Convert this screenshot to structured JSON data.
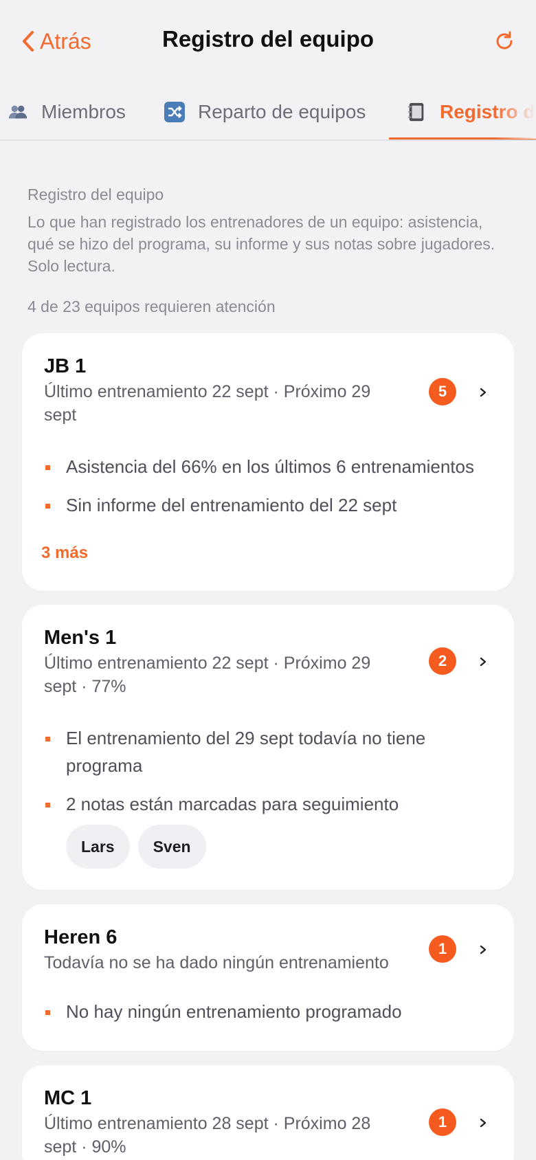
{
  "header": {
    "back_label": "Atrás",
    "title": "Registro del equipo"
  },
  "tabs": [
    {
      "label": "Miembros",
      "icon": "people-icon",
      "active": false
    },
    {
      "label": "Reparto de equipos",
      "icon": "shuffle-icon",
      "active": false
    },
    {
      "label": "Registro de",
      "icon": "notebook-icon",
      "active": true
    }
  ],
  "intro": {
    "title": "Registro del equipo",
    "description": "Lo que han registrado los entrenadores de un equipo: asistencia, qué se hizo del programa, su informe y sus notas sobre jugadores. Solo lectura.",
    "attention": "4 de 23 equipos requieren atención"
  },
  "colors": {
    "accent": "#f26a2e",
    "badge": "#f55a1e",
    "background": "#f2f2f5"
  },
  "teams": [
    {
      "name": "JB 1",
      "subtitle": "Último entrenamiento 22 sept · Próximo 29 sept",
      "badge": "5",
      "issues": [
        "Asistencia del 66% en los últimos 6 entrenamientos",
        "Sin informe del entrenamiento del 22 sept"
      ],
      "more": "3 más"
    },
    {
      "name": "Men's 1",
      "subtitle": "Último entrenamiento 22 sept · Próximo 29 sept · 77%",
      "badge": "2",
      "issues": [
        "El entrenamiento del 29 sept todavía no tiene programa",
        "2 notas están marcadas para seguimiento"
      ],
      "chips": [
        "Lars",
        "Sven"
      ]
    },
    {
      "name": "Heren 6",
      "subtitle": "Todavía no se ha dado ningún entrenamiento",
      "badge": "1",
      "issues": [
        "No hay ningún entrenamiento programado"
      ]
    },
    {
      "name": "MC 1",
      "subtitle": "Último entrenamiento 28 sept · Próximo 28 sept · 90%",
      "badge": "1"
    }
  ]
}
